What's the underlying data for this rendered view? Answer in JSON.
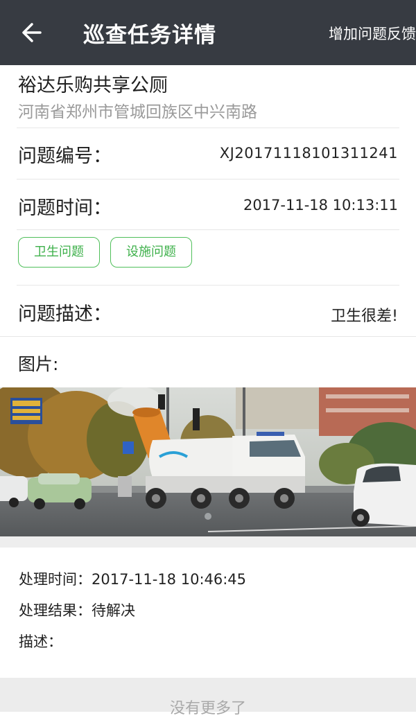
{
  "header": {
    "title": "巡查任务详情",
    "action_label": "增加问题反馈",
    "back_icon": "arrow-left-icon",
    "background": "#373b42"
  },
  "location": {
    "name": "裕达乐购共享公厕",
    "address": "河南省郑州市管城回族区中兴南路"
  },
  "details": {
    "number_label": "问题编号：",
    "number_value": "XJ20171118101311241",
    "time_label": "问题时间：",
    "time_value": "2017-11-18 10:13:11",
    "tags": [
      "卫生问题",
      "设施问题"
    ],
    "tag_color": "#4fbf5a",
    "description_label": "问题描述：",
    "description_value": "卫生很差!"
  },
  "images": {
    "label": "图片:"
  },
  "handling": {
    "time_label": "处理时间：",
    "time_value": "2017-11-18 10:46:45",
    "result_label": "处理结果：",
    "result_value": "待解决",
    "description_label": "描述："
  },
  "footer": {
    "no_more": "没有更多了"
  }
}
